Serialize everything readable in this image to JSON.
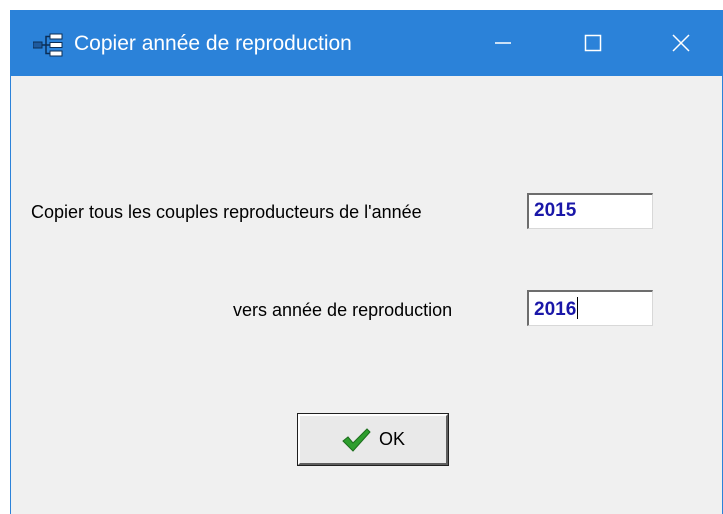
{
  "window": {
    "title": "Copier année de reproduction",
    "controls": {
      "minimize_icon": "minimize-icon",
      "maximize_icon": "maximize-icon",
      "close_icon": "close-icon"
    },
    "accent_color": "#2b82d9"
  },
  "form": {
    "source_label": "Copier tous les couples reproducteurs de l'année",
    "source_value": "2015",
    "target_label": "vers année de reproduction",
    "target_value": "2016",
    "value_color": "#1a17a8"
  },
  "buttons": {
    "ok_label": "OK",
    "ok_icon": "checkmark-icon",
    "ok_icon_color": "#2e9e2e"
  }
}
